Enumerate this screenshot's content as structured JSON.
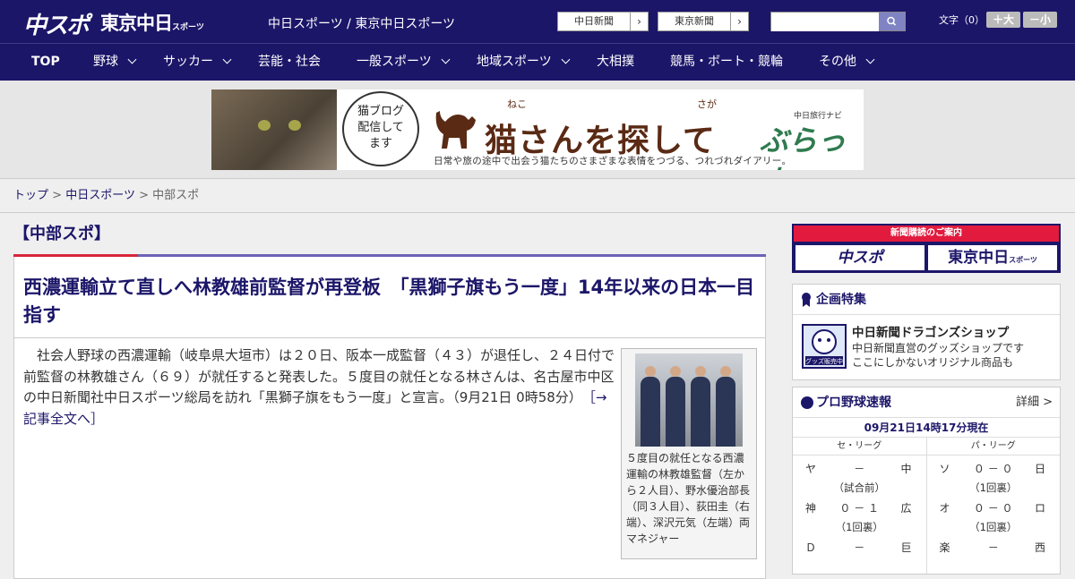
{
  "header": {
    "logo_chuspo": "中スポ",
    "logo_tokyo": "東京中日",
    "logo_tokyo_small": "スポーツ",
    "site_title": "中日スポーツ / 東京中日スポーツ",
    "ext_links": [
      {
        "label": "中日新聞",
        "arrow": "›"
      },
      {
        "label": "東京新聞",
        "arrow": "›"
      }
    ],
    "search": {
      "placeholder": "",
      "value": ""
    },
    "font_size_label": "文字（0）",
    "font_larger": "＋大",
    "font_smaller": "－小"
  },
  "nav": {
    "items": [
      {
        "label": "TOP",
        "dropdown": false
      },
      {
        "label": "野球",
        "dropdown": true
      },
      {
        "label": "サッカー",
        "dropdown": true
      },
      {
        "label": "芸能・社会",
        "dropdown": false
      },
      {
        "label": "一般スポーツ",
        "dropdown": true
      },
      {
        "label": "地域スポーツ",
        "dropdown": true
      },
      {
        "label": "大相撲",
        "dropdown": false
      },
      {
        "label": "競馬・ボート・競輪",
        "dropdown": false
      },
      {
        "label": "その他",
        "dropdown": true
      }
    ]
  },
  "banner": {
    "bubble_lines": [
      "猫ブログ",
      "配信して",
      "ます"
    ],
    "title": "猫さんを探して",
    "ruby_neko": "ねこ",
    "ruby_saga": "さが",
    "brand_small": "中日旅行ナビ",
    "brand": "ぶらっ人",
    "subtitle": "日常や旅の途中で出会う猫たちのさまざまな表情をつづる、つれづれダイアリー。"
  },
  "breadcrumb": {
    "top": "トップ",
    "sep": ">",
    "middle": "中日スポーツ",
    "current": "中部スポ"
  },
  "section": {
    "title": "【中部スポ】"
  },
  "article": {
    "headline": "西濃運輸立て直しへ林教雄前監督が再登板　「黒獅子旗もう一度」14年以来の日本一目指す",
    "body": "社会人野球の西濃運輸（岐阜県大垣市）は２０日、阪本一成監督（４３）が退任し、２４日付で前監督の林教雄さん（６９）が就任すると発表した。５度目の就任となる林さんは、名古屋市中区の中日新聞社中日スポーツ総局を訪れ「黒獅子旗をもう一度」と宣言。（9月21日 0時58分）",
    "more_link": "［→記事全文へ］",
    "photo_caption": "５度目の就任となる西濃運輸の林教雄監督（左から２人目）、野水優治部長（同３人目）、荻田圭（右端）、深沢元気（左端）両マネジャー"
  },
  "sidebar": {
    "subscription": {
      "heading": "新聞購読のご案内",
      "logo_left": "中スポ",
      "logo_right": "東京中日",
      "logo_right_small": "スポーツ"
    },
    "feature": {
      "heading": "企画特集",
      "badge_text": "グッズ販売中",
      "title": "中日新聞ドラゴンズショップ",
      "desc_line1": "中日新聞直営のグッズショップです",
      "desc_line2": "ここにしかないオリジナル商品も"
    },
    "scores": {
      "heading": "プロ野球速報",
      "detail": "詳細 >",
      "timestamp": "09月21日14時17分現在",
      "central_label": "セ・リーグ",
      "pacific_label": "パ・リーグ",
      "central": [
        {
          "home": "ヤ",
          "score": "－",
          "away": "中",
          "status": "（試合前）"
        },
        {
          "home": "神",
          "score": "０ － １",
          "away": "広",
          "status": "（1回裏）"
        },
        {
          "home": "Ｄ",
          "score": "－",
          "away": "巨",
          "status": ""
        }
      ],
      "pacific": [
        {
          "home": "ソ",
          "score": "０ － ０",
          "away": "日",
          "status": "（1回裏）"
        },
        {
          "home": "オ",
          "score": "０ － ０",
          "away": "ロ",
          "status": "（1回裏）"
        },
        {
          "home": "楽",
          "score": "－",
          "away": "西",
          "status": ""
        }
      ]
    }
  },
  "colors": {
    "brand_navy": "#1c1669",
    "accent_red": "#e21b3e",
    "accent_purple": "#6c63b5"
  }
}
